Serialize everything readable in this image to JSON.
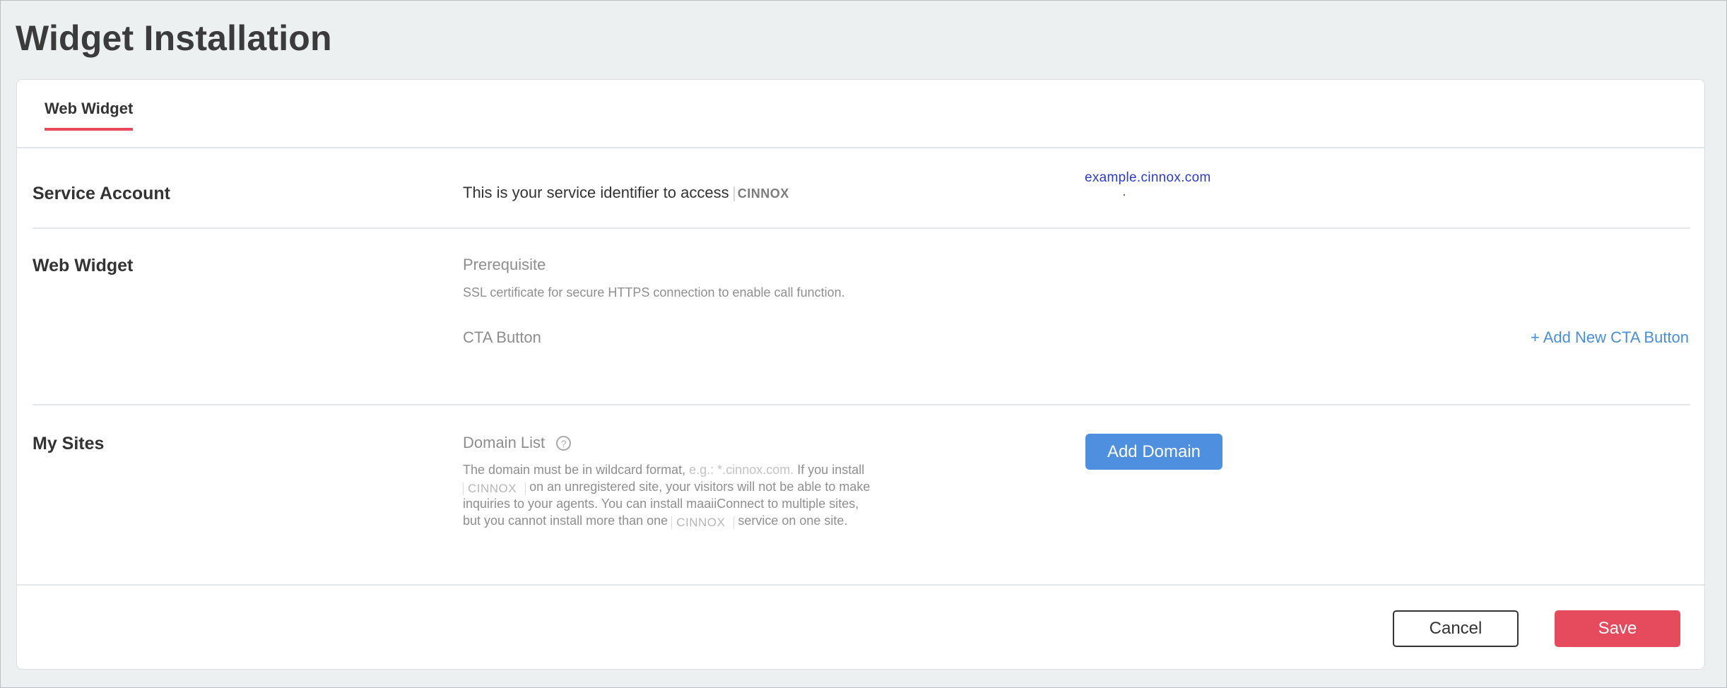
{
  "page": {
    "title": "Widget Installation"
  },
  "tabs": [
    {
      "label": "Web Widget",
      "active": true
    }
  ],
  "service_account": {
    "label": "Service Account",
    "description": "This is your service identifier to access",
    "brand": "CINNOX",
    "domain": "example.cinnox.com"
  },
  "web_widget": {
    "label": "Web Widget",
    "prerequisite_title": "Prerequisite",
    "prerequisite_note": "SSL certificate for secure HTTPS connection to enable call function.",
    "cta_title": "CTA Button",
    "add_cta_label": "+ Add New CTA Button"
  },
  "my_sites": {
    "label": "My Sites",
    "domain_list_title": "Domain List",
    "help_glyph": "?",
    "desc_part1": "The domain must be in wildcard format,",
    "desc_example": "e.g.: *.cinnox.com.",
    "desc_part2": "If you install",
    "desc_brand_1": "CINNOX",
    "desc_part3": "on an unregistered site, your visitors will not be able to make inquiries to your agents. You can install maaiiConnect to multiple sites, but you cannot install more than one",
    "desc_brand_2": "CINNOX",
    "desc_part4": "service on one site.",
    "add_domain_label": "Add Domain"
  },
  "footer": {
    "cancel_label": "Cancel",
    "save_label": "Save"
  },
  "colors": {
    "accent_red": "#e64b5d",
    "primary_blue": "#4f8fe0",
    "link_blue": "#4a8fd6",
    "domain_blue": "#2b3bc6"
  },
  "icons": {
    "help": "help-circle-icon"
  }
}
